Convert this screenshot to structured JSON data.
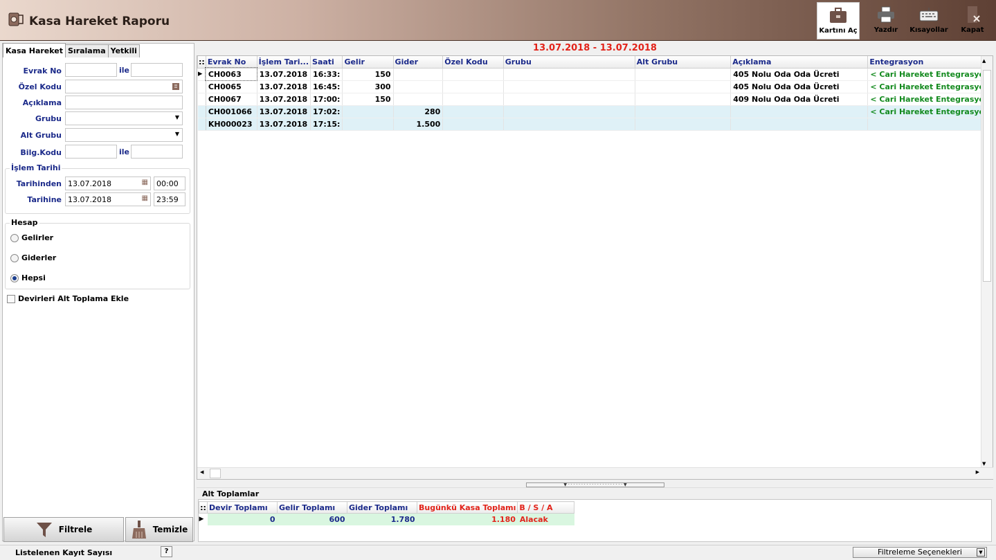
{
  "header": {
    "title": "Kasa Hareket Raporu"
  },
  "toolbar": {
    "open_card": "Kartını Aç",
    "print": "Yazdır",
    "shortcuts": "Kısayollar",
    "close": "Kapat"
  },
  "tabs": [
    {
      "label": "Kasa Hareket"
    },
    {
      "label": "Sıralama"
    },
    {
      "label": "Yetkili"
    }
  ],
  "filter": {
    "evrak_no_label": "Evrak No",
    "ile": "ile",
    "ozel_kodu_label": "Özel Kodu",
    "aciklama_label": "Açıklama",
    "grubu_label": "Grubu",
    "alt_grubu_label": "Alt Grubu",
    "bilg_kodu_label": "Bilg.Kodu",
    "islem_tarihi_title": "İşlem Tarihi",
    "tarihinden_label": "Tarihinden",
    "tarihinden_date": "13.07.2018",
    "tarihinden_time": "00:00",
    "tarihine_label": "Tarihine",
    "tarihine_date": "13.07.2018",
    "tarihine_time": "23:59",
    "hesap_title": "Hesap",
    "gelirler": "Gelirler",
    "giderler": "Giderler",
    "hepsi": "Hepsi",
    "selected": "Hepsi",
    "devir_checkbox": "Devirleri Alt Toplama Ekle"
  },
  "buttons": {
    "filter": "Filtrele",
    "clear": "Temizle"
  },
  "report": {
    "date_range": "13.07.2018 - 13.07.2018"
  },
  "grid": {
    "columns": [
      "Evrak No",
      "İşlem Tari...",
      "Saati",
      "Gelir",
      "Gider",
      "Özel Kodu",
      "Grubu",
      "Alt Grubu",
      "Açıklama",
      "Entegrasyon"
    ],
    "rows": [
      {
        "evrak": "CH0063",
        "tarih": "13.07.2018",
        "saat": "16:33:",
        "gelir": "150",
        "gider": "",
        "ozel": "",
        "grubu": "",
        "alt": "",
        "aciklama": "405  Nolu Oda Oda Ücreti",
        "ent": "< Cari Hareket Entegrasyon"
      },
      {
        "evrak": "CH0065",
        "tarih": "13.07.2018",
        "saat": "16:45:",
        "gelir": "300",
        "gider": "",
        "ozel": "",
        "grubu": "",
        "alt": "",
        "aciklama": "405  Nolu Oda Oda Ücreti",
        "ent": "< Cari Hareket Entegrasyon"
      },
      {
        "evrak": "CH0067",
        "tarih": "13.07.2018",
        "saat": "17:00:",
        "gelir": "150",
        "gider": "",
        "ozel": "",
        "grubu": "",
        "alt": "",
        "aciklama": "409 Nolu Oda Oda Ücreti",
        "ent": "< Cari Hareket Entegrasyon"
      },
      {
        "evrak": "CH001066",
        "tarih": "13.07.2018",
        "saat": "17:02:",
        "gelir": "",
        "gider": "280",
        "ozel": "",
        "grubu": "",
        "alt": "",
        "aciklama": "",
        "ent": "< Cari Hareket Entegrasyon"
      },
      {
        "evrak": "KH000023",
        "tarih": "13.07.2018",
        "saat": "17:15:",
        "gelir": "",
        "gider": "1.500",
        "ozel": "",
        "grubu": "",
        "alt": "",
        "aciklama": "",
        "ent": ""
      }
    ]
  },
  "subtotals": {
    "title": "Alt Toplamlar",
    "columns": [
      "Devir Toplamı",
      "Gelir Toplamı",
      "Gider Toplamı",
      "Bugünkü Kasa Toplamı",
      "B / S / A"
    ],
    "values": [
      "0",
      "600",
      "1.780",
      "1.180",
      "Alacak"
    ]
  },
  "status": {
    "record_count_label": "Listelenen Kayıt Sayısı",
    "help": "?",
    "filter_options": "Filtreleme Seçenekleri"
  },
  "colors": {
    "accent_red": "#e2231a",
    "label_blue": "#1b2a8a",
    "green": "#138a1e",
    "highlight": "#dff1f7"
  }
}
